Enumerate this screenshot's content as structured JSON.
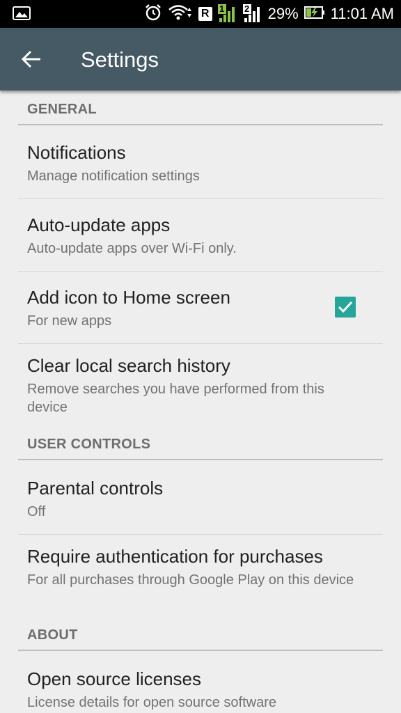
{
  "status_bar": {
    "battery": "29%",
    "time": "11:01 AM",
    "sim1": "1",
    "sim2": "2",
    "roaming": "R"
  },
  "appbar": {
    "title": "Settings"
  },
  "sections": {
    "general": "GENERAL",
    "user_controls": "USER CONTROLS",
    "about": "ABOUT"
  },
  "items": {
    "notifications": {
      "title": "Notifications",
      "subtitle": "Manage notification settings"
    },
    "auto_update": {
      "title": "Auto-update apps",
      "subtitle": "Auto-update apps over Wi-Fi only."
    },
    "add_icon": {
      "title": "Add icon to Home screen",
      "subtitle": "For new apps",
      "checked": true
    },
    "clear_history": {
      "title": "Clear local search history",
      "subtitle": "Remove searches you have performed from this device"
    },
    "parental": {
      "title": "Parental controls",
      "subtitle": "Off"
    },
    "require_auth": {
      "title": "Require authentication for purchases",
      "subtitle": "For all purchases through Google Play on this device"
    },
    "licenses": {
      "title": "Open source licenses",
      "subtitle": "License details for open source software"
    }
  },
  "colors": {
    "appbar": "#455a64",
    "accent": "#26a69a",
    "background": "#eeeeee"
  }
}
